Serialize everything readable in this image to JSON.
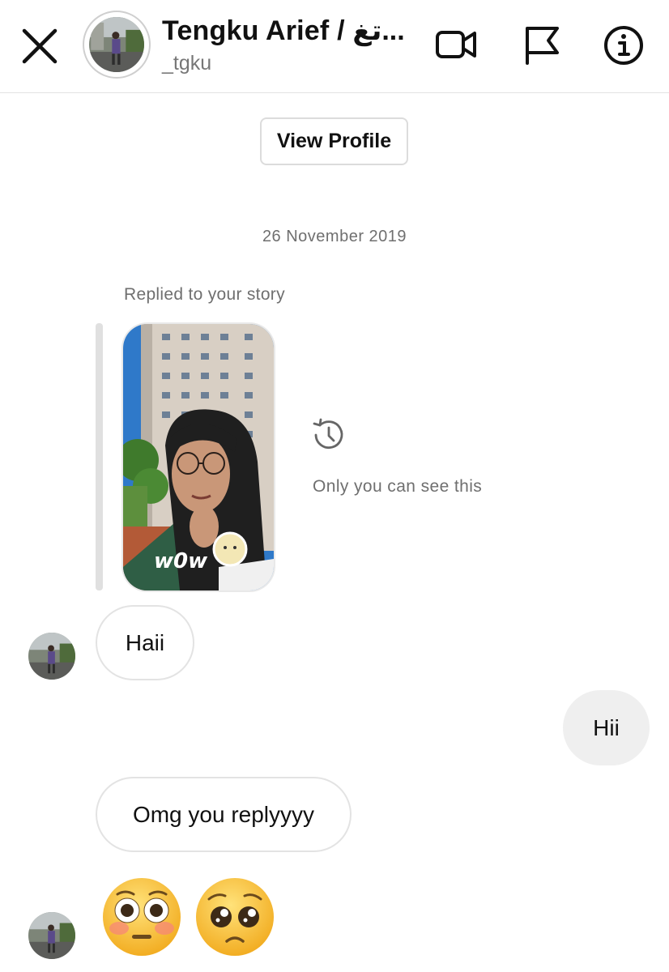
{
  "header": {
    "close_icon": "close-icon",
    "display_name": "Tengku Arief / تغ...",
    "username": "_tgku",
    "icons": [
      "video-call-icon",
      "flag-icon",
      "info-icon"
    ]
  },
  "profile_button": {
    "label": "View Profile"
  },
  "date_separator": "26 November 2019",
  "story_reply": {
    "label": "Replied to your story",
    "story_sticker_text": "w0w",
    "notice_icon": "history-icon",
    "notice_text": "Only you can see this"
  },
  "messages": [
    {
      "from": "them",
      "text": "Haii"
    },
    {
      "from": "me",
      "text": "Hii"
    },
    {
      "from": "them",
      "text": "Omg you replyyyy"
    },
    {
      "from": "them",
      "emojis": [
        "flushed-face-emoji",
        "pleading-face-emoji"
      ]
    }
  ],
  "colors": {
    "incoming_bubble_border": "#e3e3e3",
    "outgoing_bubble_bg": "#efefef",
    "muted_text": "#6f6f6f",
    "emoji_yellow": "#f7c53a"
  }
}
